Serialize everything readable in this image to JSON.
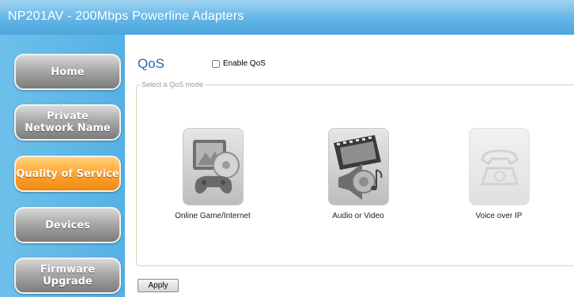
{
  "header": {
    "title": "NP201AV - 200Mbps Powerline Adapters"
  },
  "sidebar": {
    "items": [
      {
        "label": "Home",
        "active": false
      },
      {
        "label": "Private\nNetwork Name",
        "active": false
      },
      {
        "label": "Quality of Service",
        "active": true
      },
      {
        "label": "Devices",
        "active": false
      },
      {
        "label": "Firmware Upgrade",
        "active": false
      }
    ]
  },
  "main": {
    "title": "QoS",
    "enable_label": "Enable QoS",
    "enable_checked": false,
    "group_legend": "Select a QoS mode",
    "modes": [
      {
        "label": "Online Game/Internet",
        "icon": "game-internet-icon",
        "enabled": true
      },
      {
        "label": "Audio or Video",
        "icon": "audio-video-icon",
        "enabled": true
      },
      {
        "label": "Voice over IP",
        "icon": "telephone-icon",
        "enabled": false
      }
    ],
    "apply_label": "Apply"
  },
  "colors": {
    "header_blue": "#62b5e6",
    "sidebar_blue": "#5ab4e6",
    "active_orange": "#ffa532",
    "title_blue": "#2a6aa6"
  }
}
